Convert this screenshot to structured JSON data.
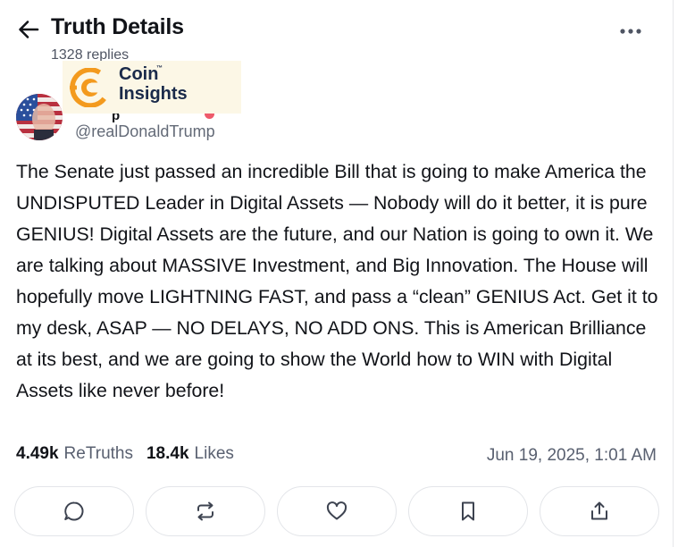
{
  "header": {
    "title": "Truth Details",
    "replies": "1328 replies"
  },
  "watermark": {
    "line1": "Coin",
    "line2": "Insights",
    "tm": "™"
  },
  "author": {
    "handle": "@realDonaldTrump"
  },
  "post": {
    "text": "The Senate just passed an incredible Bill that is going to make America the UNDISPUTED Leader in Digital Assets — Nobody will do it better, it is pure GENIUS! Digital Assets are the future, and our Nation is going to own it. We are talking about MASSIVE Investment, and Big Innovation. The House will hopefully move LIGHTNING FAST, and pass a “clean” GENIUS Act. Get it to my desk, ASAP — NO DELAYS, NO ADD ONS. This is American Brilliance at its best, and we are going to show the World how to WIN with Digital Assets like never before!"
  },
  "stats": {
    "retruths_count": "4.49k",
    "retruths_label": "ReTruths",
    "likes_count": "18.4k",
    "likes_label": "Likes",
    "timestamp": "Jun 19, 2025, 1:01 AM"
  },
  "actions": [
    "reply-icon",
    "retruth-icon",
    "like-icon",
    "bookmark-icon",
    "share-icon"
  ],
  "colors": {
    "text": "#111318",
    "muted": "#596070",
    "border": "#e3e5e9",
    "watermark_orange": "#f39a1e",
    "watermark_navy": "#1a2a4a"
  }
}
